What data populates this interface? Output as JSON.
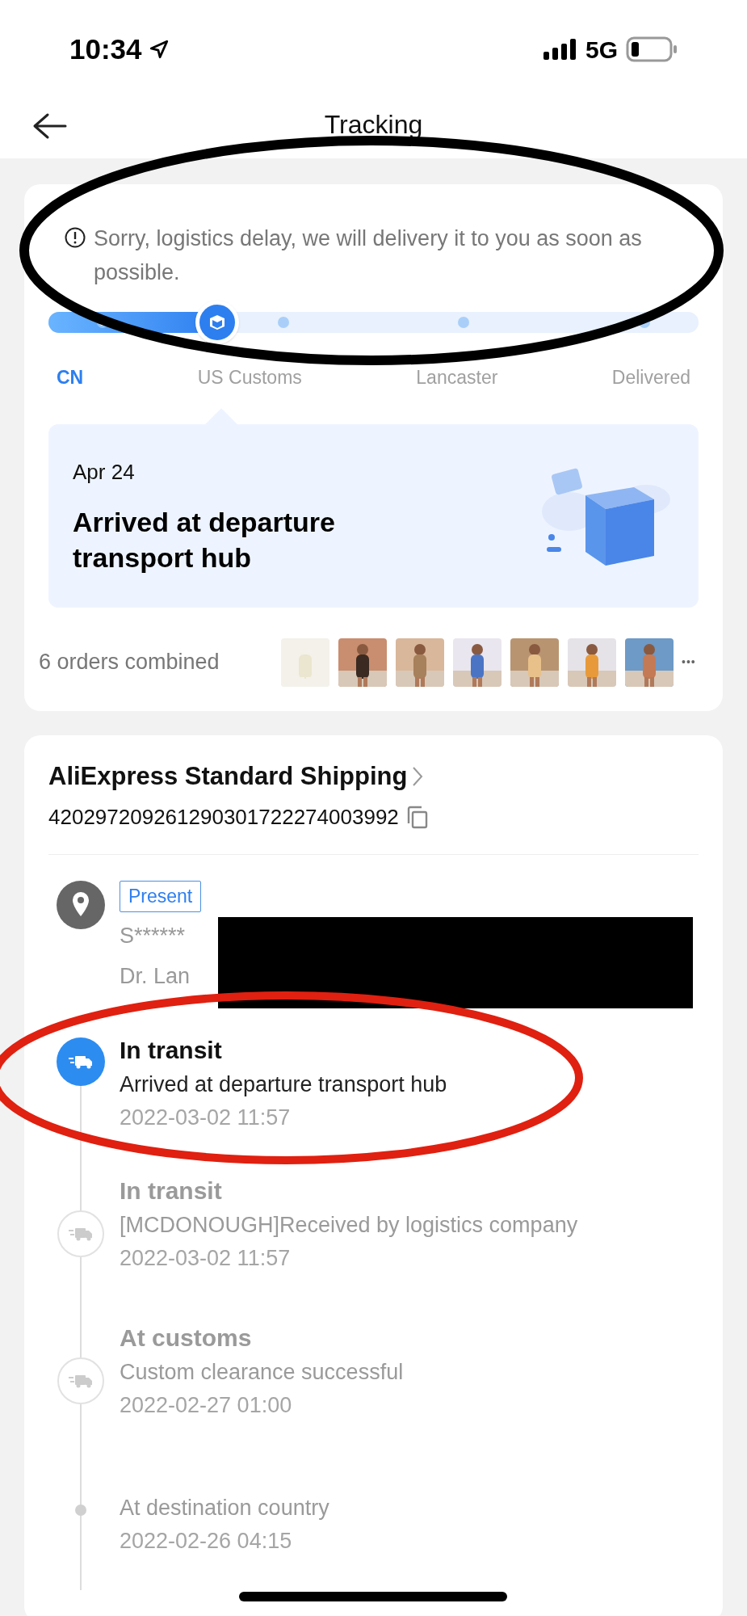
{
  "status_bar": {
    "time": "10:34",
    "network": "5G"
  },
  "header": {
    "title": "Tracking"
  },
  "notice": {
    "text": "Sorry, logistics delay, we will delivery it to you as soon as possible."
  },
  "progress": {
    "level": 0.26,
    "stages": [
      {
        "label": "CN",
        "reached": true
      },
      {
        "label": "US Customs",
        "reached": false
      },
      {
        "label": "Lancaster",
        "reached": false
      },
      {
        "label": "Delivered",
        "reached": false
      }
    ]
  },
  "latest": {
    "date": "Apr 24",
    "status": "Arrived at departure transport hub"
  },
  "orders": {
    "label": "6 orders combined",
    "more": "•••"
  },
  "shipping": {
    "carrier": "AliExpress Standard Shipping",
    "tracking_number": "420297209261290301722274003992"
  },
  "address": {
    "tag": "Present",
    "line_1": "S******",
    "line_2": "Dr. Lan"
  },
  "events": [
    {
      "kind": "current",
      "title": "In transit",
      "detail": "Arrived at departure transport hub",
      "time": "2022-03-02 11:57"
    },
    {
      "kind": "past",
      "title": "In transit",
      "detail": "[MCDONOUGH]Received by logistics company",
      "time": "2022-03-02 11:57"
    },
    {
      "kind": "past",
      "title": "At customs",
      "detail": "Custom clearance successful",
      "time": "2022-02-27 01:00"
    },
    {
      "kind": "minor",
      "detail": "At destination country",
      "time": "2022-02-26 04:15"
    }
  ]
}
